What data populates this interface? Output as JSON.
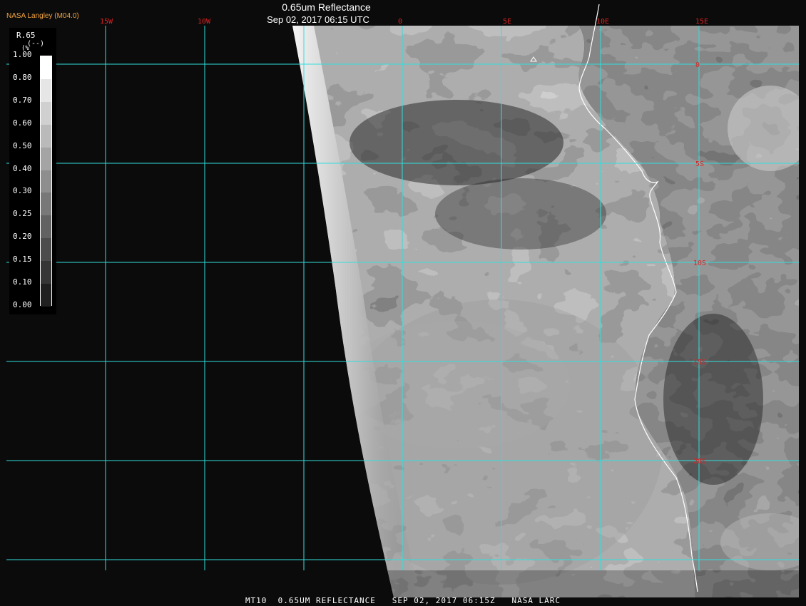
{
  "header": {
    "credit": "NASA Langley (M04.0)",
    "title": "0.65um Reflectance",
    "timestamp": "Sep 02, 2017 06:15 UTC"
  },
  "footer": {
    "caption": "MT10  0.65UM REFLECTANCE   SEP 02, 2017 06:15Z   NASA LARC"
  },
  "colorbar": {
    "title": "R.65",
    "unit": "(--)",
    "unit_prefix": "(%",
    "ticks": [
      "1.00",
      "0.80",
      "0.70",
      "0.60",
      "0.50",
      "0.40",
      "0.30",
      "0.25",
      "0.20",
      "0.15",
      "0.10",
      "0.00"
    ],
    "levels": [
      1.0,
      0.8,
      0.7,
      0.6,
      0.5,
      0.4,
      0.3,
      0.25,
      0.2,
      0.15,
      0.1,
      0.0
    ]
  },
  "grid": {
    "line_color": "#33dddd",
    "label_color": "#dd2222",
    "lon_labels": [
      "15W",
      "10W",
      "0",
      "5E",
      "10E",
      "15E"
    ],
    "lat_labels": [
      "0",
      "5S",
      "10S",
      "15S",
      "20S"
    ]
  },
  "colors": {
    "background": "#000000",
    "credit": "#f2a341",
    "coastline": "#ffffff"
  }
}
